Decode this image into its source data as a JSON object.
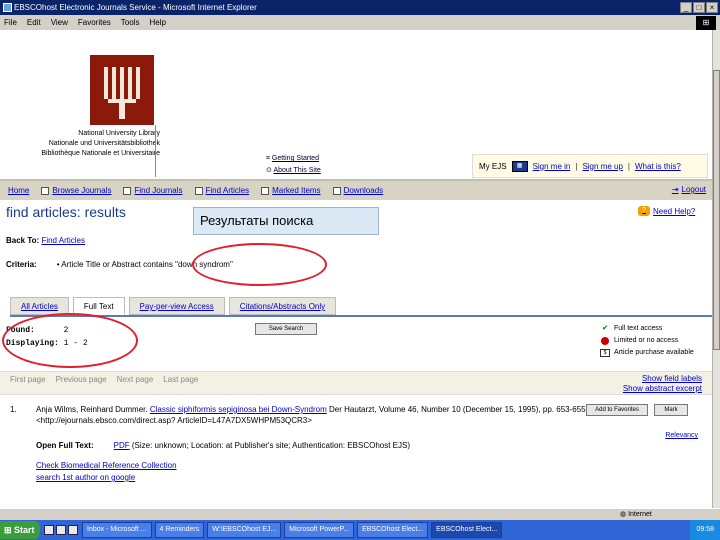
{
  "window": {
    "title": "EBSCOhost Electronic Journals Service - Microsoft Internet Explorer",
    "controls": [
      "_",
      "□",
      "×"
    ]
  },
  "menu": [
    "File",
    "Edit",
    "View",
    "Favorites",
    "Tools",
    "Help"
  ],
  "library": {
    "lines": [
      "National University Library",
      "Nationale und Universitätsbibliothek",
      "Bibliothèque Nationale et Universitaire"
    ]
  },
  "header_links": [
    "Getting Started",
    "About This Site"
  ],
  "myejs": {
    "label": "My EJS",
    "signin": "Sign me in",
    "signup": "Sign me up",
    "whatis": "What is this?"
  },
  "nav": {
    "items": [
      "Home",
      "Browse Journals",
      "Find Journals",
      "Find Articles",
      "Marked Items",
      "Downloads"
    ],
    "logout": "Logout"
  },
  "page": {
    "title": "find articles: results",
    "overlay": "Результаты поиска",
    "help": "Need Help?",
    "back_label": "Back To:",
    "back_link": "Find Articles",
    "criteria_label": "Criteria:",
    "criteria_value": "Article Title or Abstract contains \"down syndrom\""
  },
  "tabs": [
    "All Articles",
    "Full Text",
    "Pay-per-view Access",
    "Citations/Abstracts Only"
  ],
  "summary": {
    "found_label": "Found:",
    "found_value": "2",
    "displaying_label": "Displaying:",
    "displaying_value": "1 - 2",
    "save_button": "Save Search"
  },
  "legend": [
    "Full text access",
    "Limited or no access",
    "Article purchase available"
  ],
  "pager": [
    "First page",
    "Previous page",
    "Next page",
    "Last page"
  ],
  "show_links": [
    "Show field labels",
    "Show abstract excerpt"
  ],
  "results": [
    {
      "number": "1.",
      "authors": "Anja Wilms, Reinhard Dummer.",
      "title": "Classic siphiformis sepiginosa bei Down-Syndrom",
      "citation": "Der Hautarzt, Volume 46, Number 10 (December 15, 1995), pp. 653-655, <http://ejournals.ebsco.com/direct.asp? ArticleID=L47A7DX5WHPM53QCR3>",
      "add_button": "Add to Favorites",
      "mark_button": "Mark",
      "relevancy": "Relevancy",
      "open_label": "Open Full Text:",
      "open_link": "PDF",
      "location": "(Size: unknown; Location: at Publisher's site; Authentication: EBSCOhost EJS)",
      "more_links": [
        "Check Biomedical Reference Collection",
        "search 1st author on google"
      ]
    }
  ],
  "status": {
    "zone": "Internet"
  },
  "taskbar": {
    "start": "Start",
    "tasks": [
      "Inbox - Microsoft ...",
      "4 Reminders",
      "W:\\EBSCOhost EJ...",
      "Microsoft PowerP...",
      "EBSCOhost Elect...",
      "EBSCOhost Elect..."
    ],
    "clock": "09:58"
  }
}
